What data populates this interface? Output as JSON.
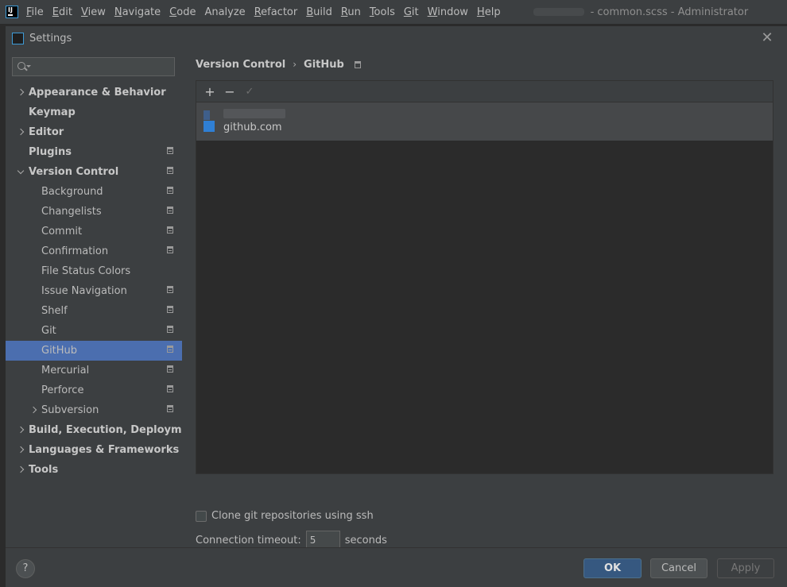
{
  "menubar": {
    "items": [
      {
        "label": "File",
        "mnemonic": "F",
        "rest": "ile"
      },
      {
        "label": "Edit",
        "mnemonic": "E",
        "rest": "dit"
      },
      {
        "label": "View",
        "mnemonic": "V",
        "rest": "iew"
      },
      {
        "label": "Navigate",
        "mnemonic": "N",
        "rest": "avigate"
      },
      {
        "label": "Code",
        "mnemonic": "C",
        "rest": "ode"
      },
      {
        "label": "Analyze",
        "mnemonic": "",
        "rest": "Analyze"
      },
      {
        "label": "Refactor",
        "mnemonic": "R",
        "rest": "efactor"
      },
      {
        "label": "Build",
        "mnemonic": "B",
        "rest": "uild"
      },
      {
        "label": "Run",
        "mnemonic": "R",
        "rest": "un"
      },
      {
        "label": "Tools",
        "mnemonic": "T",
        "rest": "ools"
      },
      {
        "label": "Git",
        "mnemonic": "G",
        "rest": "it"
      },
      {
        "label": "Window",
        "mnemonic": "W",
        "rest": "indow"
      },
      {
        "label": "Help",
        "mnemonic": "H",
        "rest": "elp"
      }
    ],
    "window_title": "- common.scss - Administrator"
  },
  "dialog": {
    "title": "Settings",
    "close": "✕"
  },
  "search": {
    "placeholder": "",
    "value": ""
  },
  "tree": [
    {
      "label": "Appearance & Behavior",
      "level": 0,
      "bold": true,
      "arrow": "right",
      "proj": false
    },
    {
      "label": "Keymap",
      "level": 0,
      "bold": true,
      "arrow": "",
      "proj": false
    },
    {
      "label": "Editor",
      "level": 0,
      "bold": true,
      "arrow": "right",
      "proj": false
    },
    {
      "label": "Plugins",
      "level": 0,
      "bold": true,
      "arrow": "",
      "proj": true
    },
    {
      "label": "Version Control",
      "level": 0,
      "bold": true,
      "arrow": "down",
      "proj": true
    },
    {
      "label": "Background",
      "level": 1,
      "bold": false,
      "arrow": "",
      "proj": true
    },
    {
      "label": "Changelists",
      "level": 1,
      "bold": false,
      "arrow": "",
      "proj": true
    },
    {
      "label": "Commit",
      "level": 1,
      "bold": false,
      "arrow": "",
      "proj": true
    },
    {
      "label": "Confirmation",
      "level": 1,
      "bold": false,
      "arrow": "",
      "proj": true
    },
    {
      "label": "File Status Colors",
      "level": 1,
      "bold": false,
      "arrow": "",
      "proj": false
    },
    {
      "label": "Issue Navigation",
      "level": 1,
      "bold": false,
      "arrow": "",
      "proj": true
    },
    {
      "label": "Shelf",
      "level": 1,
      "bold": false,
      "arrow": "",
      "proj": true
    },
    {
      "label": "Git",
      "level": 1,
      "bold": false,
      "arrow": "",
      "proj": true
    },
    {
      "label": "GitHub",
      "level": 1,
      "bold": false,
      "arrow": "",
      "proj": true,
      "selected": true
    },
    {
      "label": "Mercurial",
      "level": 1,
      "bold": false,
      "arrow": "",
      "proj": true
    },
    {
      "label": "Perforce",
      "level": 1,
      "bold": false,
      "arrow": "",
      "proj": true
    },
    {
      "label": "Subversion",
      "level": 1,
      "bold": false,
      "arrow": "right",
      "proj": true
    },
    {
      "label": "Build, Execution, Deployment",
      "level": 0,
      "bold": true,
      "arrow": "right",
      "proj": false
    },
    {
      "label": "Languages & Frameworks",
      "level": 0,
      "bold": true,
      "arrow": "right",
      "proj": false
    },
    {
      "label": "Tools",
      "level": 0,
      "bold": true,
      "arrow": "right",
      "proj": false
    }
  ],
  "breadcrumb": {
    "parent": "Version Control",
    "separator": "›",
    "current": "GitHub"
  },
  "accounts": {
    "toolbar": {
      "add": "+",
      "remove": "−",
      "set_default": "✓"
    },
    "items": [
      {
        "server": "github.com"
      }
    ]
  },
  "options": {
    "clone_ssh_label": "Clone git repositories using ssh",
    "clone_ssh_checked": false,
    "timeout_label": "Connection timeout:",
    "timeout_value": "5",
    "timeout_unit": "seconds"
  },
  "footer": {
    "help": "?",
    "ok": "OK",
    "cancel": "Cancel",
    "apply": "Apply"
  }
}
